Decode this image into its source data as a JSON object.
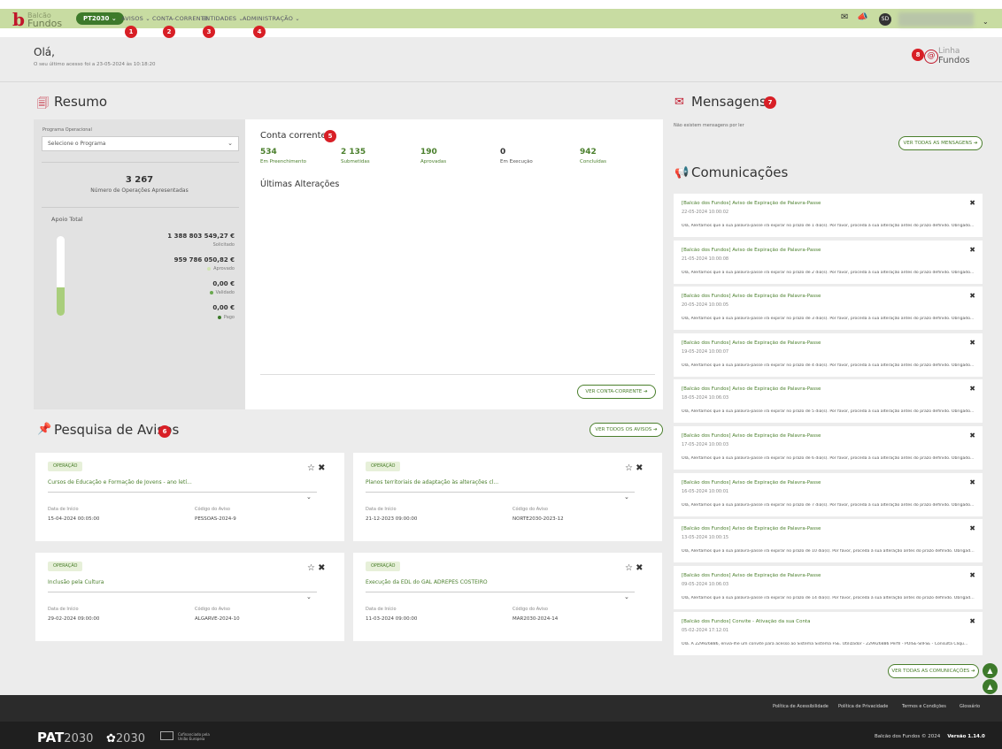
{
  "header": {
    "logo_line1": "Balcão",
    "logo_line2": "Fundos",
    "program_pill": "PT2030",
    "nav": [
      "AVISOS",
      "CONTA-CORRENTE",
      "ENTIDADES",
      "ADMINISTRAÇÃO"
    ],
    "user_initials": "SD",
    "badges": [
      "1",
      "2",
      "3",
      "4"
    ]
  },
  "greeting": {
    "hello": "Olá,",
    "last_access": "O seu último acesso foi a 23-05-2024 às 10:18:20"
  },
  "linha": {
    "line1": "Linha",
    "line2": "Fundos",
    "badge": "8"
  },
  "resumo": {
    "title": "Resumo",
    "programa_label": "Programa Operacional",
    "programa_select": "Selecione o Programa",
    "operacoes_count": "3 267",
    "operacoes_label": "Número de Operações Apresentadas",
    "apoio_title": "Apoio Total",
    "apoio": [
      {
        "value": "1 388 803 549,27 €",
        "label": "Solicitado"
      },
      {
        "value": "959 786 050,82 €",
        "label": "Aprovado"
      },
      {
        "value": "0,00 €",
        "label": "Validado"
      },
      {
        "value": "0,00 €",
        "label": "Pago"
      }
    ],
    "bar_fill_fraction": 0.36
  },
  "conta": {
    "title": "Conta corrente",
    "badge": "5",
    "stats": [
      {
        "value": "534",
        "label": "Em Preenchimento"
      },
      {
        "value": "2 135",
        "label": "Submetidas"
      },
      {
        "value": "190",
        "label": "Aprovadas"
      },
      {
        "value": "0",
        "label": "Em Execução"
      },
      {
        "value": "942",
        "label": "Concluídas"
      }
    ],
    "ultimas": "Últimas Alterações",
    "button": "VER CONTA-CORRENTE ➔"
  },
  "pesquisa": {
    "title": "Pesquisa de Avisos",
    "badge": "6",
    "button": "VER TODOS OS AVISOS ➔",
    "field_start": "Data de Início",
    "field_code": "Código do Aviso",
    "cards": [
      {
        "tag": "OPERAÇÃO",
        "title": "Cursos de Educação e Formação de Jovens - ano letí...",
        "start": "15-04-2024 00:05:00",
        "code": "PESSOAS-2024-9"
      },
      {
        "tag": "OPERAÇÃO",
        "title": "Planos territoriais de adaptação às alterações cl...",
        "start": "21-12-2023 09:00:00",
        "code": "NORTE2030-2023-12"
      },
      {
        "tag": "OPERAÇÃO",
        "title": "Inclusão pela Cultura",
        "start": "29-02-2024 09:00:00",
        "code": "ALGARVE-2024-10"
      },
      {
        "tag": "OPERAÇÃO",
        "title": "Execução da EDL do GAL ADREPES COSTEIRO",
        "start": "11-03-2024 09:00:00",
        "code": "MAR2030-2024-14"
      }
    ]
  },
  "mensagens": {
    "title": "Mensagens",
    "badge": "7",
    "none": "Não existem mensagens por ler",
    "button": "VER TODAS AS MENSAGENS ➔"
  },
  "comunicacoes": {
    "title": "Comunicações",
    "button": "VER TODAS AS COMUNICAÇÕES ➔",
    "items": [
      {
        "title": "[Balcão dos Fundos] Aviso de Expiração de Palavra-Passe",
        "date": "22-05-2024 10:00:02",
        "body": "Olá, Alertamos que a sua palavra-passe irá expirar no prazo de 1 dia(s). Por favor, proceda à sua alteração antes do prazo definido. Obrigado..."
      },
      {
        "title": "[Balcão dos Fundos] Aviso de Expiração de Palavra-Passe",
        "date": "21-05-2024 10:00:08",
        "body": "Olá, Alertamos que a sua palavra-passe irá expirar no prazo de 2 dia(s). Por favor, proceda à sua alteração antes do prazo definido. Obrigado..."
      },
      {
        "title": "[Balcão dos Fundos] Aviso de Expiração de Palavra-Passe",
        "date": "20-05-2024 10:00:05",
        "body": "Olá, Alertamos que a sua palavra-passe irá expirar no prazo de 3 dia(s). Por favor, proceda à sua alteração antes do prazo definido. Obrigado..."
      },
      {
        "title": "[Balcão dos Fundos] Aviso de Expiração de Palavra-Passe",
        "date": "19-05-2024 10:00:07",
        "body": "Olá, Alertamos que a sua palavra-passe irá expirar no prazo de 4 dia(s). Por favor, proceda à sua alteração antes do prazo definido. Obrigado..."
      },
      {
        "title": "[Balcão dos Fundos] Aviso de Expiração de Palavra-Passe",
        "date": "18-05-2024 10:06:03",
        "body": "Olá, Alertamos que a sua palavra-passe irá expirar no prazo de 5 dia(s). Por favor, proceda à sua alteração antes do prazo definido. Obrigado..."
      },
      {
        "title": "[Balcão dos Fundos] Aviso de Expiração de Palavra-Passe",
        "date": "17-05-2024 10:00:03",
        "body": "Olá, Alertamos que a sua palavra-passe irá expirar no prazo de 6 dia(s). Por favor, proceda à sua alteração antes do prazo definido. Obrigado..."
      },
      {
        "title": "[Balcão dos Fundos] Aviso de Expiração de Palavra-Passe",
        "date": "16-05-2024 10:00:01",
        "body": "Olá, Alertamos que a sua palavra-passe irá expirar no prazo de 7 dia(s). Por favor, proceda à sua alteração antes do prazo definido. Obrigado..."
      },
      {
        "title": "[Balcão dos Fundos] Aviso de Expiração de Palavra-Passe",
        "date": "13-05-2024 10:00:15",
        "body": "Olá, Alertamos que a sua palavra-passe irá expirar no prazo de 10 dia(s). Por favor, proceda à sua alteração antes do prazo definido. Obrigado..."
      },
      {
        "title": "[Balcão dos Fundos] Aviso de Expiração de Palavra-Passe",
        "date": "09-05-2024 10:06:03",
        "body": "Olá, Alertamos que a sua palavra-passe irá expirar no prazo de 14 dia(s). Por favor, proceda à sua alteração antes do prazo definido. Obrigado..."
      },
      {
        "title": "[Balcão dos Fundos] Convite - Ativação da sua Conta",
        "date": "05-02-2024 17:12:01",
        "body": "Olá. A 229926886, envia-lhe um convite para acesso ao Sistema Sistema FSE. Utilizador - 229926886 Perfil - POISE-SIIFSE - Consulta Cliqu..."
      }
    ]
  },
  "footer": {
    "links": [
      "Política de Acessibilidade",
      "Política de Privacidade",
      "Termos e Condições",
      "Glossário"
    ],
    "pat_a": "PAT",
    "pat_b": "2030",
    "pt_b": "2030",
    "eu_text_1": "Cofinanciado pela",
    "eu_text_2": "União Europeia",
    "copyright": "Balcão dos Fundos © 2024",
    "version": "Versão 1.14.0"
  },
  "colors": {
    "brand_red": "#c0172b",
    "brand_green": "#3d7a2b",
    "header_green": "#c8dca2"
  }
}
